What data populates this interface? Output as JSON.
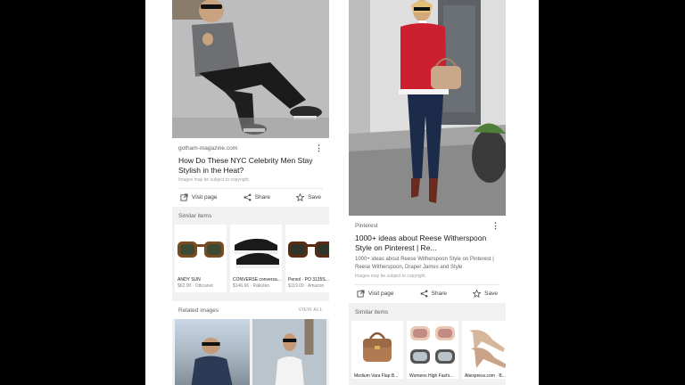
{
  "left": {
    "result": {
      "source": "gotham-magazine.com",
      "title": "How Do These NYC Celebrity Men Stay Stylish in the Heat?",
      "note": "Images may be subject to copyright."
    },
    "actions": {
      "visit": "Visit page",
      "share": "Share",
      "save": "Save"
    },
    "similar_heading": "Similar items",
    "similar": [
      {
        "label": "ANDY SUN",
        "sub": "$62.00 · Otticanet"
      },
      {
        "label": "CONVERSE conversa...",
        "sub": "$146.66 · Rakuten"
      },
      {
        "label": "Persol · PO 3135S...",
        "sub": "$119.00 · Amazon"
      }
    ],
    "related_heading": "Related images",
    "view_all": "VIEW ALL"
  },
  "right": {
    "result": {
      "source": "Pinterest",
      "title": "1000+ ideas about Reese Witherspoon Style on Pinterest | Re...",
      "description": "1000+ ideas about Reese Witherspoon Style on Pinterest | Reese Witherspoon, Draper James and Style",
      "note": "Images may be subject to copyright."
    },
    "actions": {
      "visit": "Visit page",
      "share": "Share",
      "save": "Save"
    },
    "similar_heading": "Similar items",
    "similar": [
      {
        "label": "Medium Vara Flap B..."
      },
      {
        "label": "Womens High Fashi..."
      },
      {
        "label": "Aliexpress.com · B..."
      }
    ]
  },
  "colors": {
    "background": "#000000",
    "frame": "#ffffff",
    "card": "#ffffff",
    "panel": "#f1f1f1",
    "red_sweater": "#cc1f2f"
  },
  "icons": [
    "open-in-new-icon",
    "share-icon",
    "star-icon",
    "more-vert-icon"
  ]
}
